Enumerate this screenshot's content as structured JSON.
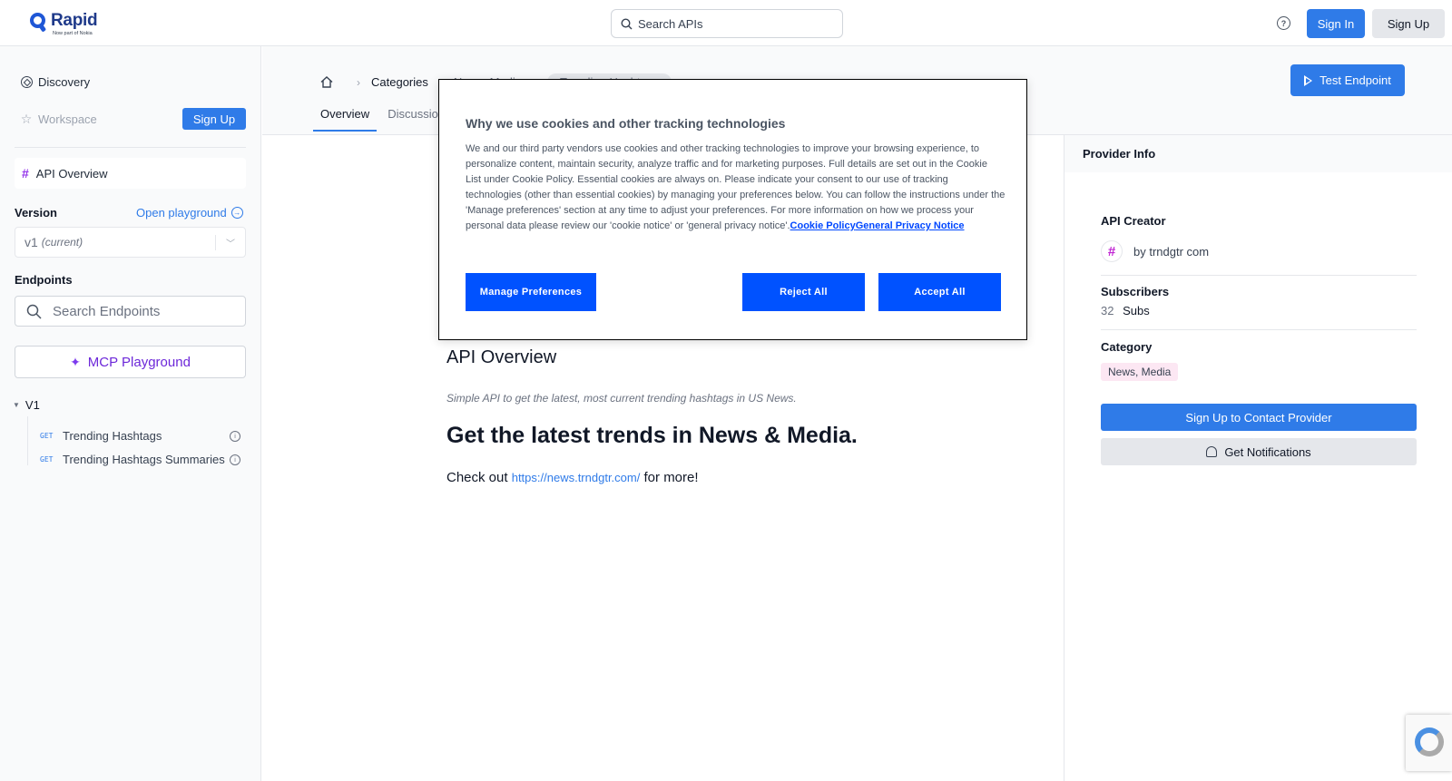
{
  "header": {
    "logo_name": "Rapid",
    "logo_sub": "Now part of Nokia",
    "search_placeholder": "Search APIs",
    "sign_in": "Sign In",
    "sign_up": "Sign Up"
  },
  "sidebar": {
    "discovery": "Discovery",
    "workspace": "Workspace",
    "sign_up": "Sign Up",
    "api_overview": "API Overview",
    "version_label": "Version",
    "open_playground": "Open playground",
    "version_value": "v1",
    "version_note": "(current)",
    "endpoints_label": "Endpoints",
    "search_endpoints_placeholder": "Search Endpoints",
    "mcp_playground": "MCP Playground",
    "group": "V1",
    "endpoints": [
      {
        "method": "GET",
        "name": "Trending Hashtags"
      },
      {
        "method": "GET",
        "name": "Trending Hashtags Summaries"
      }
    ]
  },
  "main": {
    "breadcrumbs": [
      "Categories",
      "News, Media",
      "Trending Hashtags"
    ],
    "tabs": [
      "Overview",
      "Discussions"
    ],
    "test_endpoint": "Test Endpoint",
    "title": "API Overview",
    "description": "Simple API to get the latest, most current trending hashtags in US News.",
    "heading": "Get the latest trends in News & Media.",
    "check_out_prefix": "Check out",
    "link": "https://news.trndgtr.com/",
    "check_out_suffix": "for more!"
  },
  "provider": {
    "header": "Provider Info",
    "creator_label": "API Creator",
    "creator": "trndgtr com",
    "creator_prefix": "by",
    "subscribers_label": "Subscribers",
    "subscribers_count": "32",
    "subscribers_unit": "Subs",
    "category_label": "Category",
    "category": "News, Media",
    "contact_btn": "Sign Up to Contact Provider",
    "notif_btn": "Get Notifications"
  },
  "cookie": {
    "title": "Why we use cookies and other tracking technologies",
    "body": "We and our third party vendors use cookies and other tracking technologies to improve your browsing experience, to personalize content, maintain security, analyze traffic and for marketing purposes. Full details are set out in the Cookie List under Cookie Policy. Essential cookies are always on. Please indicate your consent to our use of tracking technologies (other than essential cookies) by managing your preferences below. You can follow the instructions under the 'Manage preferences' section at any time to adjust your preferences. For more information on how we process your personal data please review our 'cookie notice' or 'general privacy notice'.",
    "link_cookie_policy": "Cookie Policy",
    "link_privacy": "General Privacy Notice",
    "manage": "Manage Preferences",
    "reject": "Reject All",
    "accept": "Accept All"
  },
  "colors": {
    "accent": "#2f7be8",
    "cookie_button": "#0052ff",
    "mcp_purple": "#6d28d9"
  }
}
